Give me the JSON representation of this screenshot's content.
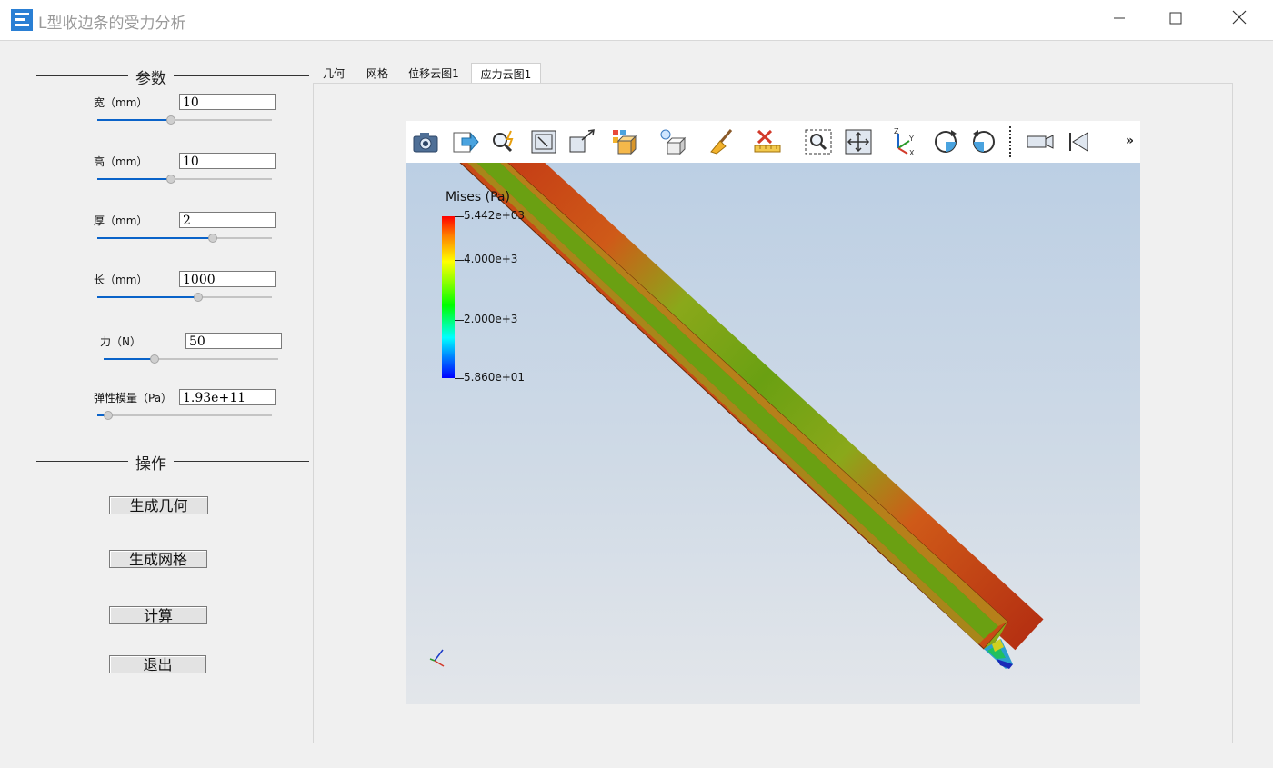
{
  "window": {
    "title": "L型收边条的受力分析",
    "minimize_glyph": "—",
    "maximize_glyph": "☐",
    "close_glyph": "✕"
  },
  "params": {
    "section_title": "参数",
    "items": [
      {
        "label": "宽（mm）",
        "value": "10",
        "slider": 0.42
      },
      {
        "label": "高（mm）",
        "value": "10",
        "slider": 0.42
      },
      {
        "label": "厚（mm）",
        "value": "2",
        "slider": 0.67
      },
      {
        "label": "长（mm）",
        "value": "1000",
        "slider": 0.58
      },
      {
        "label": "力（N）",
        "value": "50",
        "slider": 0.28
      },
      {
        "label": "弹性模量（Pa）",
        "value": "1.93e+11",
        "slider": 0.04
      }
    ]
  },
  "operations": {
    "section_title": "操作",
    "generate_geometry": "生成几何",
    "generate_mesh": "生成网格",
    "compute": "计算",
    "exit": "退出"
  },
  "tabs": [
    {
      "label": "几何",
      "active": false
    },
    {
      "label": "网格",
      "active": false
    },
    {
      "label": "位移云图1",
      "active": false
    },
    {
      "label": "应力云图1",
      "active": true
    }
  ],
  "toolbar": {
    "icons": [
      "camera-icon",
      "export-icon",
      "zoom-select-icon",
      "fit-box-icon",
      "box-arrow-icon",
      "color-cube-icon",
      "light-cube-icon",
      "broom-icon",
      "ruler-icon",
      "zoom-box-icon",
      "pan-icon",
      "axes-icon",
      "rotate-cw-icon",
      "rotate-ccw-icon",
      "video-camera-icon",
      "reset-view-icon"
    ],
    "more_label": "»"
  },
  "colorbar": {
    "title": "Mises (Pa)",
    "labels": [
      "5.442e+03",
      "4.000e+3",
      "2.000e+3",
      "5.860e+01"
    ],
    "max": 5442,
    "min": 58.6,
    "ticks": [
      5442,
      4000,
      2000,
      58.6
    ]
  },
  "colors": {
    "accent": "#0a63c9",
    "bar_outer": "#d03a1a",
    "bar_inner": "#6aa012"
  }
}
